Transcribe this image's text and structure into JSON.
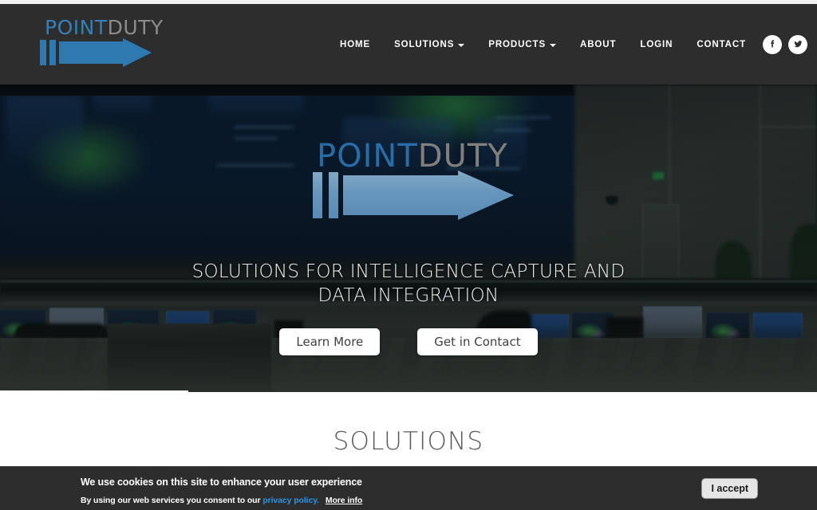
{
  "header": {
    "logo": {
      "part1": "POINT",
      "part2": "DUTY",
      "icon": "arrow-right-logo"
    },
    "nav": [
      {
        "label": "HOME",
        "has_dropdown": false
      },
      {
        "label": "SOLUTIONS",
        "has_dropdown": true
      },
      {
        "label": "PRODUCTS",
        "has_dropdown": true
      },
      {
        "label": "ABOUT",
        "has_dropdown": false
      },
      {
        "label": "LOGIN",
        "has_dropdown": false
      },
      {
        "label": "CONTACT",
        "has_dropdown": false
      }
    ],
    "social": [
      {
        "name": "facebook-icon",
        "label": "f"
      },
      {
        "name": "twitter-icon",
        "label": "t"
      }
    ]
  },
  "hero": {
    "logo": {
      "part1": "POINT",
      "part2": "DUTY"
    },
    "tagline_line1": "SOLUTIONS FOR INTELLIGENCE CAPTURE AND",
    "tagline_line2": "DATA INTEGRATION",
    "primary_button": "Learn More",
    "secondary_button": "Get in Contact"
  },
  "solutions": {
    "title": "SOLUTIONS"
  },
  "cookie": {
    "headline": "We use cookies on this site to enhance your user experience",
    "body_prefix": "By using our web services you consent to our",
    "link_text": "privacy policy.",
    "more_info": "More info",
    "accept_label": "I accept"
  },
  "colors": {
    "brand_blue": "#3281bd",
    "hero_arrow_blue": "#7cb2dd",
    "header_bg": "#2d2d2d",
    "cookie_link": "#2f93e0"
  }
}
